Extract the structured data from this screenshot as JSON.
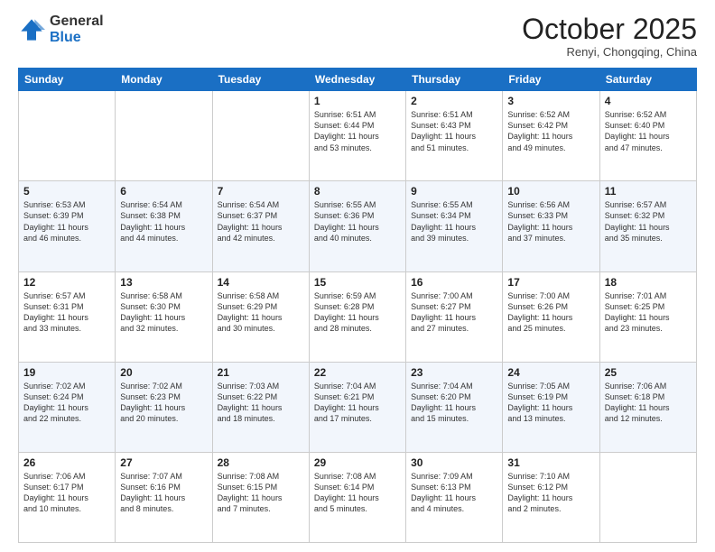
{
  "header": {
    "logo_general": "General",
    "logo_blue": "Blue",
    "month": "October 2025",
    "location": "Renyi, Chongqing, China"
  },
  "days_of_week": [
    "Sunday",
    "Monday",
    "Tuesday",
    "Wednesday",
    "Thursday",
    "Friday",
    "Saturday"
  ],
  "weeks": [
    [
      {
        "day": "",
        "info": ""
      },
      {
        "day": "",
        "info": ""
      },
      {
        "day": "",
        "info": ""
      },
      {
        "day": "1",
        "info": "Sunrise: 6:51 AM\nSunset: 6:44 PM\nDaylight: 11 hours\nand 53 minutes."
      },
      {
        "day": "2",
        "info": "Sunrise: 6:51 AM\nSunset: 6:43 PM\nDaylight: 11 hours\nand 51 minutes."
      },
      {
        "day": "3",
        "info": "Sunrise: 6:52 AM\nSunset: 6:42 PM\nDaylight: 11 hours\nand 49 minutes."
      },
      {
        "day": "4",
        "info": "Sunrise: 6:52 AM\nSunset: 6:40 PM\nDaylight: 11 hours\nand 47 minutes."
      }
    ],
    [
      {
        "day": "5",
        "info": "Sunrise: 6:53 AM\nSunset: 6:39 PM\nDaylight: 11 hours\nand 46 minutes."
      },
      {
        "day": "6",
        "info": "Sunrise: 6:54 AM\nSunset: 6:38 PM\nDaylight: 11 hours\nand 44 minutes."
      },
      {
        "day": "7",
        "info": "Sunrise: 6:54 AM\nSunset: 6:37 PM\nDaylight: 11 hours\nand 42 minutes."
      },
      {
        "day": "8",
        "info": "Sunrise: 6:55 AM\nSunset: 6:36 PM\nDaylight: 11 hours\nand 40 minutes."
      },
      {
        "day": "9",
        "info": "Sunrise: 6:55 AM\nSunset: 6:34 PM\nDaylight: 11 hours\nand 39 minutes."
      },
      {
        "day": "10",
        "info": "Sunrise: 6:56 AM\nSunset: 6:33 PM\nDaylight: 11 hours\nand 37 minutes."
      },
      {
        "day": "11",
        "info": "Sunrise: 6:57 AM\nSunset: 6:32 PM\nDaylight: 11 hours\nand 35 minutes."
      }
    ],
    [
      {
        "day": "12",
        "info": "Sunrise: 6:57 AM\nSunset: 6:31 PM\nDaylight: 11 hours\nand 33 minutes."
      },
      {
        "day": "13",
        "info": "Sunrise: 6:58 AM\nSunset: 6:30 PM\nDaylight: 11 hours\nand 32 minutes."
      },
      {
        "day": "14",
        "info": "Sunrise: 6:58 AM\nSunset: 6:29 PM\nDaylight: 11 hours\nand 30 minutes."
      },
      {
        "day": "15",
        "info": "Sunrise: 6:59 AM\nSunset: 6:28 PM\nDaylight: 11 hours\nand 28 minutes."
      },
      {
        "day": "16",
        "info": "Sunrise: 7:00 AM\nSunset: 6:27 PM\nDaylight: 11 hours\nand 27 minutes."
      },
      {
        "day": "17",
        "info": "Sunrise: 7:00 AM\nSunset: 6:26 PM\nDaylight: 11 hours\nand 25 minutes."
      },
      {
        "day": "18",
        "info": "Sunrise: 7:01 AM\nSunset: 6:25 PM\nDaylight: 11 hours\nand 23 minutes."
      }
    ],
    [
      {
        "day": "19",
        "info": "Sunrise: 7:02 AM\nSunset: 6:24 PM\nDaylight: 11 hours\nand 22 minutes."
      },
      {
        "day": "20",
        "info": "Sunrise: 7:02 AM\nSunset: 6:23 PM\nDaylight: 11 hours\nand 20 minutes."
      },
      {
        "day": "21",
        "info": "Sunrise: 7:03 AM\nSunset: 6:22 PM\nDaylight: 11 hours\nand 18 minutes."
      },
      {
        "day": "22",
        "info": "Sunrise: 7:04 AM\nSunset: 6:21 PM\nDaylight: 11 hours\nand 17 minutes."
      },
      {
        "day": "23",
        "info": "Sunrise: 7:04 AM\nSunset: 6:20 PM\nDaylight: 11 hours\nand 15 minutes."
      },
      {
        "day": "24",
        "info": "Sunrise: 7:05 AM\nSunset: 6:19 PM\nDaylight: 11 hours\nand 13 minutes."
      },
      {
        "day": "25",
        "info": "Sunrise: 7:06 AM\nSunset: 6:18 PM\nDaylight: 11 hours\nand 12 minutes."
      }
    ],
    [
      {
        "day": "26",
        "info": "Sunrise: 7:06 AM\nSunset: 6:17 PM\nDaylight: 11 hours\nand 10 minutes."
      },
      {
        "day": "27",
        "info": "Sunrise: 7:07 AM\nSunset: 6:16 PM\nDaylight: 11 hours\nand 8 minutes."
      },
      {
        "day": "28",
        "info": "Sunrise: 7:08 AM\nSunset: 6:15 PM\nDaylight: 11 hours\nand 7 minutes."
      },
      {
        "day": "29",
        "info": "Sunrise: 7:08 AM\nSunset: 6:14 PM\nDaylight: 11 hours\nand 5 minutes."
      },
      {
        "day": "30",
        "info": "Sunrise: 7:09 AM\nSunset: 6:13 PM\nDaylight: 11 hours\nand 4 minutes."
      },
      {
        "day": "31",
        "info": "Sunrise: 7:10 AM\nSunset: 6:12 PM\nDaylight: 11 hours\nand 2 minutes."
      },
      {
        "day": "",
        "info": ""
      }
    ]
  ]
}
